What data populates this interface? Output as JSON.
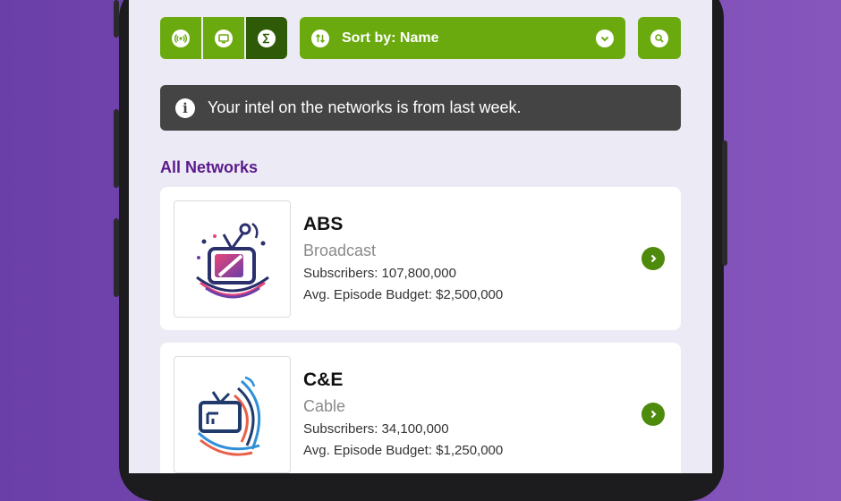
{
  "toolbar": {
    "segments": [
      {
        "icon": "broadcast-icon"
      },
      {
        "icon": "tv-icon"
      },
      {
        "icon": "sigma-icon"
      }
    ],
    "sort_icon": "sort-arrows-icon",
    "sort_label": "Sort by: Name",
    "sort_chevron": "chevron-down-icon",
    "search_icon": "search-icon"
  },
  "notice": {
    "icon": "info-icon",
    "glyph": "i",
    "text": "Your intel on the networks is from last week."
  },
  "section": {
    "title": "All Networks"
  },
  "networks": [
    {
      "name": "ABS",
      "type": "Broadcast",
      "subscribers": "Subscribers: 107,800,000",
      "budget": "Avg. Episode Budget: $2,500,000",
      "logo_icon": "abs-tv-logo-icon"
    },
    {
      "name": "C&E",
      "type": "Cable",
      "subscribers": "Subscribers: 34,100,000",
      "budget": "Avg. Episode Budget: $1,250,000",
      "logo_icon": "ce-tv-logo-icon"
    }
  ],
  "colors": {
    "accent_green": "#6aaa0e",
    "selected_green": "#2f5a08",
    "heading_purple": "#5a1a8c",
    "notice_bg": "#444444",
    "background_purple": "#7a4bb3"
  }
}
